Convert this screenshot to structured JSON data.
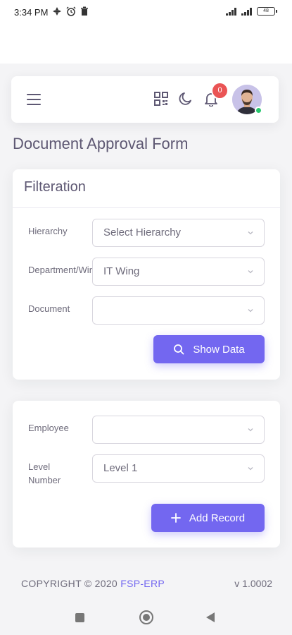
{
  "status_bar": {
    "time": "3:34 PM",
    "battery": "48"
  },
  "navbar": {
    "notification_count": "0"
  },
  "page": {
    "title": "Document Approval Form"
  },
  "filter_card": {
    "title": "Filteration",
    "fields": [
      {
        "label": "Hierarchy",
        "value": "Select Hierarchy"
      },
      {
        "label": "Department/Wing",
        "value": "IT Wing"
      },
      {
        "label": "Document",
        "value": ""
      }
    ],
    "show_data_label": "Show Data"
  },
  "record_card": {
    "fields": [
      {
        "label": "Employee",
        "value": ""
      },
      {
        "label": "Level Number",
        "value": "Level 1"
      }
    ],
    "add_record_label": "Add Record"
  },
  "footer": {
    "copyright_prefix": "COPYRIGHT © 2020",
    "brand": "FSP-ERP",
    "version": "v 1.0002"
  },
  "colors": {
    "primary": "#7367f0",
    "danger": "#ea5455",
    "success": "#28c76f"
  }
}
